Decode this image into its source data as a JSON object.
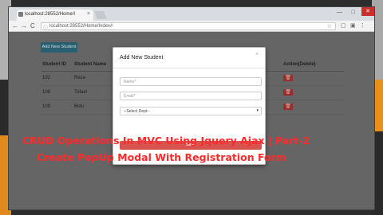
{
  "browser": {
    "tab_title": "localhost:28552/Home/I",
    "tab_close": "×",
    "window_close": "✕",
    "url": "localhost:28552/Home/Index#",
    "nav_back": "←",
    "nav_forward": "→",
    "nav_reload": "C",
    "star": "☆"
  },
  "page": {
    "add_button_label": "Add New Student",
    "columns": [
      "Student ID",
      "Student Name",
      "",
      "Action(Delete)"
    ],
    "rows": [
      {
        "id": "102",
        "name": "Reza"
      },
      {
        "id": "108",
        "name": "Tofael"
      },
      {
        "id": "109",
        "name": "Bidu"
      }
    ],
    "trash_icon": "🗑"
  },
  "modal": {
    "title": "Add New Student",
    "close": "×",
    "name_placeholder": "Name*",
    "email_placeholder": "Email*",
    "dept_select": "--Select Dept--",
    "dept_caret": "▾",
    "save_label": "Save"
  },
  "caption": {
    "line1": "CRUD Operations In MVC  Using Jquery Ajax | Part-2",
    "line2": "Create PopUp Modal With Registration Form"
  },
  "colors": {
    "accent_red": "#ff2a2a",
    "save_button": "#d9534f",
    "add_button": "#2a6172"
  }
}
